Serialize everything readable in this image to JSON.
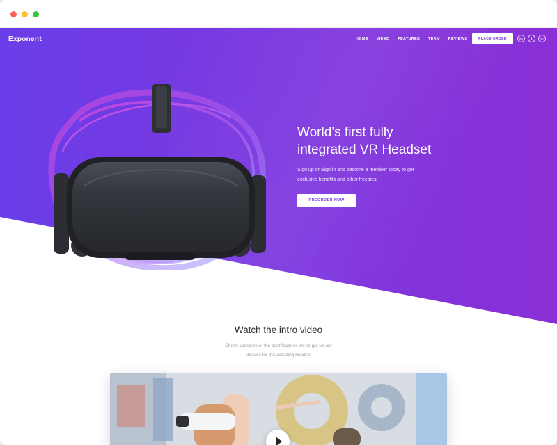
{
  "window": {
    "controls": [
      "close",
      "minimize",
      "maximize"
    ]
  },
  "nav": {
    "brand": "Exponent",
    "links": [
      "HOME",
      "VIDEO",
      "FEATURES",
      "TEAM",
      "REVIEWS"
    ],
    "order_button": "PLACE ORDER",
    "social": [
      {
        "icon": "linkedin-icon",
        "glyph": "in"
      },
      {
        "icon": "twitter-icon",
        "glyph": "t"
      },
      {
        "icon": "instagram-icon",
        "glyph": "◎"
      }
    ]
  },
  "hero": {
    "title_line1": "World’s first fully",
    "title_line2": "integrated VR Headset",
    "subtitle_line1": "Sign up or Sign in and become a member today to get",
    "subtitle_line2": "exclusive benefits and other freebies.",
    "preorder_button": "PREORDER NOW"
  },
  "video_section": {
    "title": "Watch the intro video",
    "subtitle_line1": "Check out some of the best features we've got up our",
    "subtitle_line2": "sleeves for this amazing headset"
  },
  "colors": {
    "hero_start": "#6a3ee8",
    "hero_end": "#8a2fd6",
    "accent": "#7b3fe4",
    "headset": "#2d2f34"
  }
}
